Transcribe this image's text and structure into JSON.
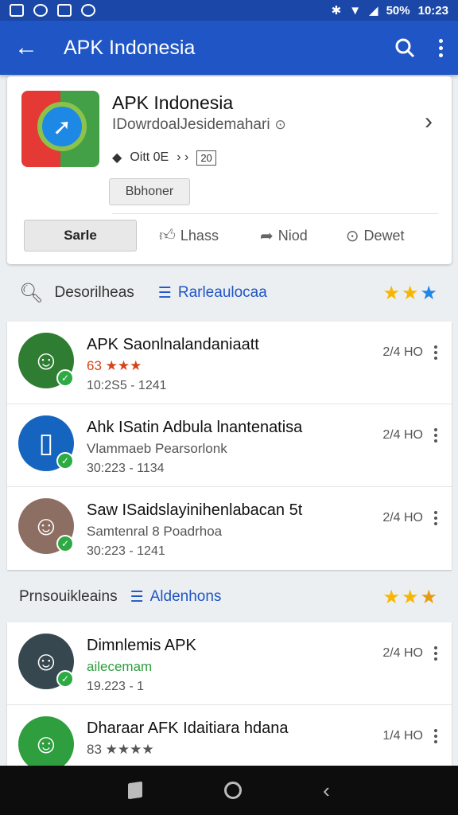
{
  "status": {
    "battery": "50%",
    "time": "10:23"
  },
  "appbar": {
    "title": "APK Indonesia"
  },
  "app": {
    "name": "APK Indonesia",
    "developer": "IDowrdoalJesidemahari",
    "meta": "Oitt 0E",
    "rated": "20",
    "chip": "Bbhoner",
    "save_label": "Sarle",
    "like_label": "Lhass",
    "mod_label": "Niod",
    "download_label": "Dewet"
  },
  "section1": {
    "title": "Desorilheas",
    "link": "Rarleaulocaa"
  },
  "list1": [
    {
      "title": "APK Saonlnalandaniaatt",
      "sub": "63 ★★★",
      "date": "10:2S5 - 1241",
      "size": "2/4 HO"
    },
    {
      "title": "Ahk ISatin Adbula lnantenatisa",
      "sub": "Vlammaeb Pearsorlonk",
      "date": "30:223 - 1134",
      "size": "2/4 HO"
    },
    {
      "title": "Saw ISaidslayinihenlabacan 5t",
      "sub": "Samtenral 8 Poadrhoa",
      "date": "30:223 - 1241",
      "size": "2/4 HO"
    }
  ],
  "section2": {
    "title": "Prnsouikleains",
    "link": "Aldenhons"
  },
  "list2": [
    {
      "title": "Dimnlemis APK",
      "sub": "ailecemam",
      "date": "19.223 - 1",
      "size": "2/4 HO"
    },
    {
      "title": "Dharaar AFK Idaitiara hdana",
      "sub": "83 ★★★★",
      "date": "",
      "size": "1/4 HO"
    }
  ]
}
